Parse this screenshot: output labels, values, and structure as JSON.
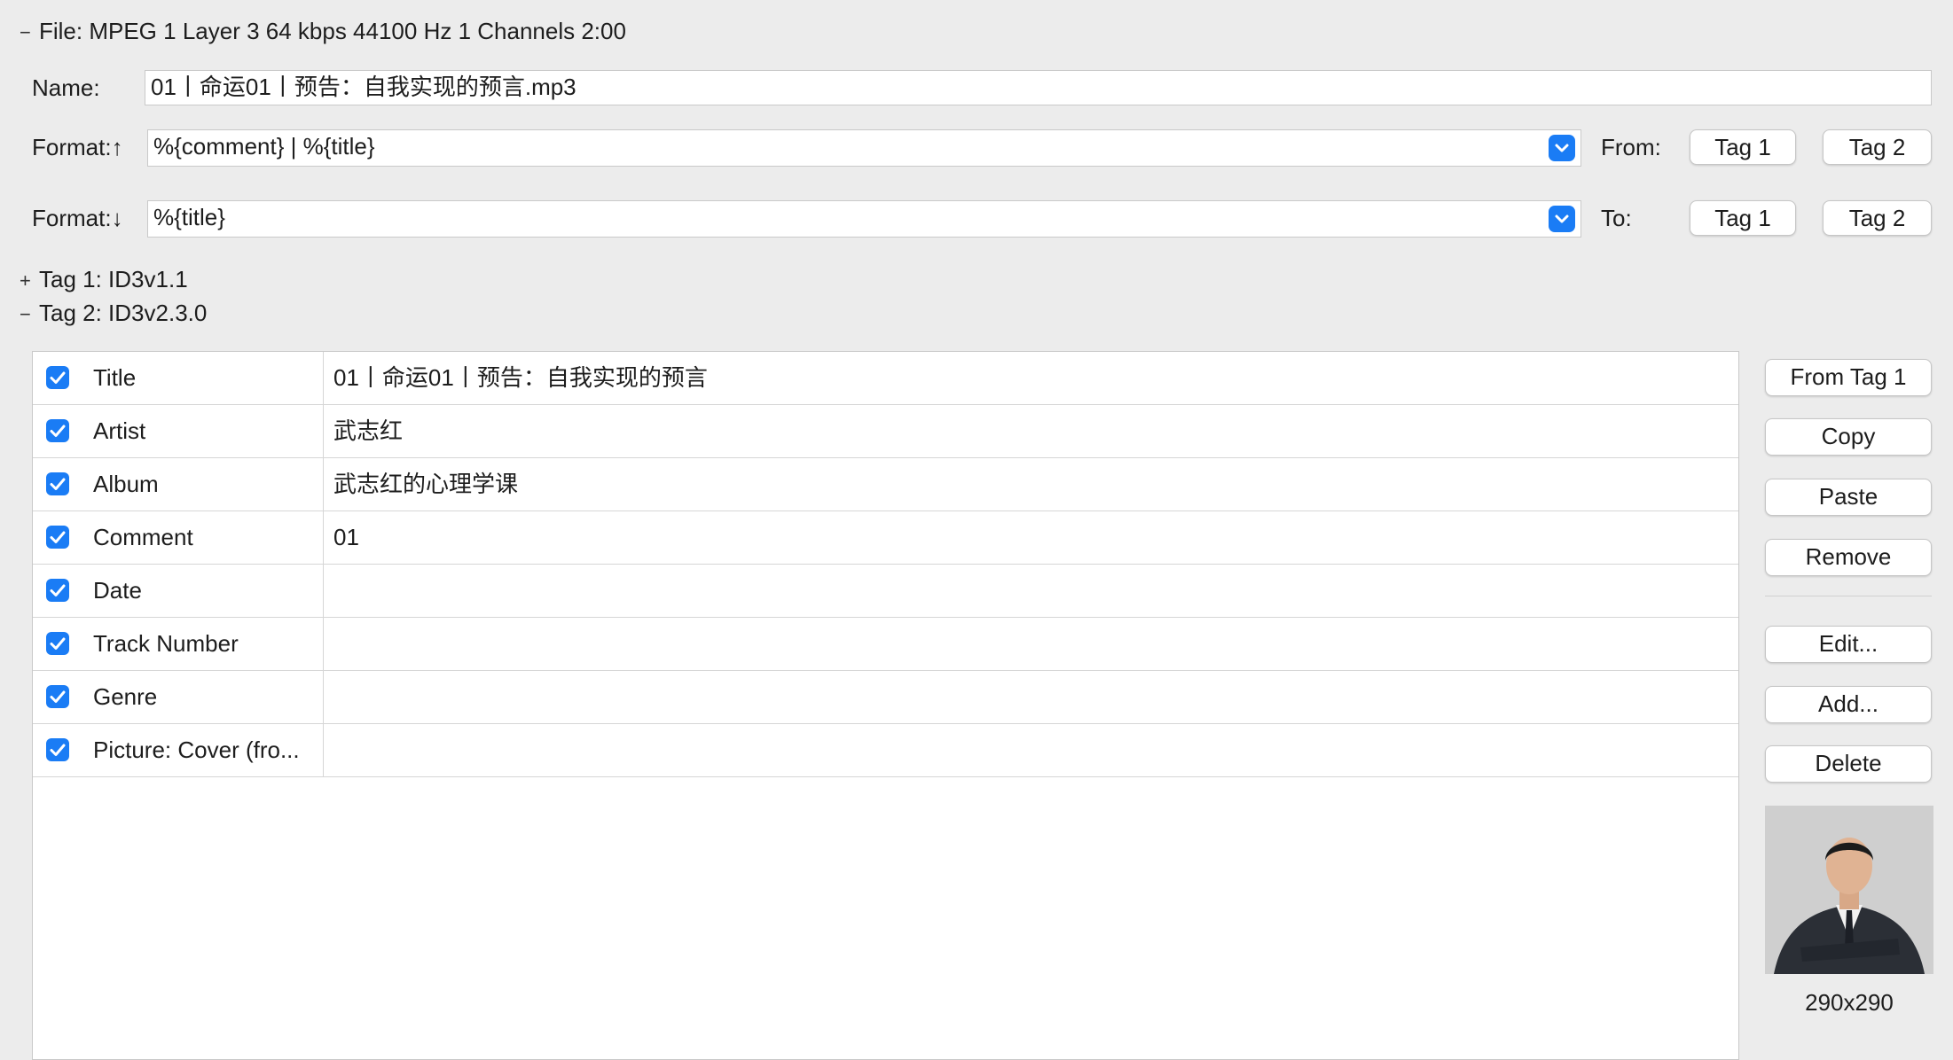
{
  "file_section": {
    "toggle": "−",
    "label": "File: MPEG 1 Layer 3 64 kbps 44100 Hz 1 Channels 2:00"
  },
  "name_row": {
    "label": "Name:",
    "value": "01丨命运01丨预告：自我实现的预言.mp3"
  },
  "format_up": {
    "label": "Format:↑",
    "value": "%{comment} | %{title}",
    "from_label": "From:",
    "tag1": "Tag 1",
    "tag2": "Tag 2"
  },
  "format_down": {
    "label": "Format:↓",
    "value": "%{title}",
    "to_label": "To:",
    "tag1": "Tag 1",
    "tag2": "Tag 2"
  },
  "tag1_section": {
    "toggle": "+",
    "label": "Tag 1: ID3v1.1"
  },
  "tag2_section": {
    "toggle": "−",
    "label": "Tag 2: ID3v2.3.0"
  },
  "frames": [
    {
      "name": "Title",
      "value": "01丨命运01丨预告：自我实现的预言",
      "checked": true
    },
    {
      "name": "Artist",
      "value": "武志红",
      "checked": true
    },
    {
      "name": "Album",
      "value": "武志红的心理学课",
      "checked": true
    },
    {
      "name": "Comment",
      "value": "01",
      "checked": true
    },
    {
      "name": "Date",
      "value": "",
      "checked": true
    },
    {
      "name": "Track Number",
      "value": "",
      "checked": true
    },
    {
      "name": "Genre",
      "value": "",
      "checked": true
    },
    {
      "name": "Picture: Cover (fro...",
      "value": "",
      "checked": true
    }
  ],
  "side_buttons": {
    "from_tag1": "From Tag 1",
    "copy": "Copy",
    "paste": "Paste",
    "remove": "Remove",
    "edit": "Edit...",
    "add": "Add...",
    "delete": "Delete"
  },
  "cover": {
    "size_label": "290x290",
    "icon": "person-portrait-icon"
  },
  "colors": {
    "accent": "#1a7cf5",
    "background": "#ececec"
  }
}
